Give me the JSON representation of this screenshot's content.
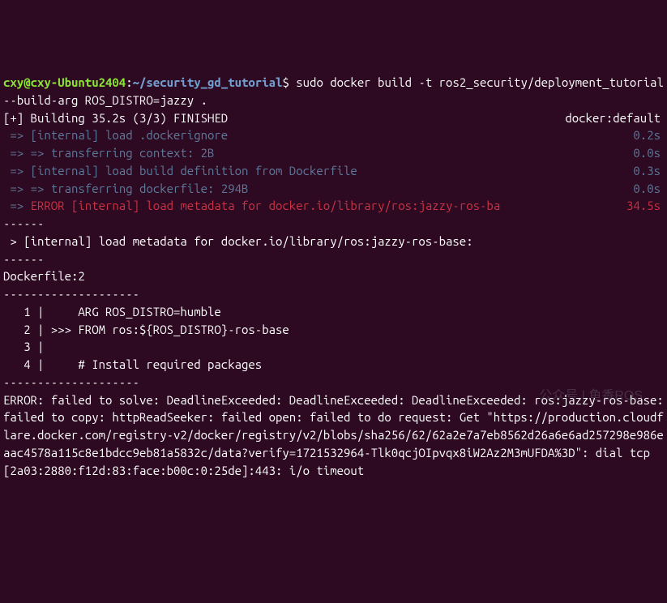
{
  "prompt": {
    "user": "cxy",
    "at": "@",
    "host": "cxy-Ubuntu2404",
    "colon": ":",
    "path": "~/security_gd_tutorial",
    "dollar": "$",
    "command": " sudo docker build -t ros2_security/deployment_tutorial --build-arg ROS_DISTRO=jazzy ."
  },
  "build_header": {
    "left": "[+] Building 35.2s (3/3) FINISHED",
    "right": "docker:default"
  },
  "steps": [
    {
      "arrow": " => ",
      "text": "[internal] load .dockerignore",
      "time": "0.2s"
    },
    {
      "arrow": " => => ",
      "text": "transferring context: 2B",
      "time": "0.0s"
    },
    {
      "arrow": " => ",
      "text": "[internal] load build definition from Dockerfile",
      "time": "0.3s"
    },
    {
      "arrow": " => => ",
      "text": "transferring dockerfile: 294B",
      "time": "0.0s"
    }
  ],
  "error_step": {
    "arrow": " => ",
    "text": "ERROR [internal] load metadata for docker.io/library/ros:jazzy-ros-ba",
    "time": "34.5s"
  },
  "sep1": "------",
  "meta_line": " > [internal] load metadata for docker.io/library/ros:jazzy-ros-base:",
  "sep2": "------",
  "dockerfile_label": "Dockerfile:2",
  "dash1": "--------------------",
  "df_lines": {
    "l1": "   1 |     ARG ROS_DISTRO=humble",
    "l2": "   2 | >>> FROM ros:${ROS_DISTRO}-ros-base",
    "l3": "   3 |     ",
    "l4": "   4 |     # Install required packages"
  },
  "dash2": "--------------------",
  "error_block": "ERROR: failed to solve: DeadlineExceeded: DeadlineExceeded: DeadlineExceeded: ros:jazzy-ros-base: failed to copy: httpReadSeeker: failed open: failed to do request: Get \"https://production.cloudflare.docker.com/registry-v2/docker/registry/v2/blobs/sha256/62/62a2e7a7eb8562d26a6e6ad257298e986eaac4578a115c8e1bdcc9eb81a5832c/data?verify=1721532964-Tlk0qcjOIpvqx8iW2Az2M3mUFDA%3D\": dial tcp [2a03:2880:f12d:83:face:b00c:0:25de]:443: i/o timeout",
  "watermark": "公众号 | 鱼香ROS"
}
